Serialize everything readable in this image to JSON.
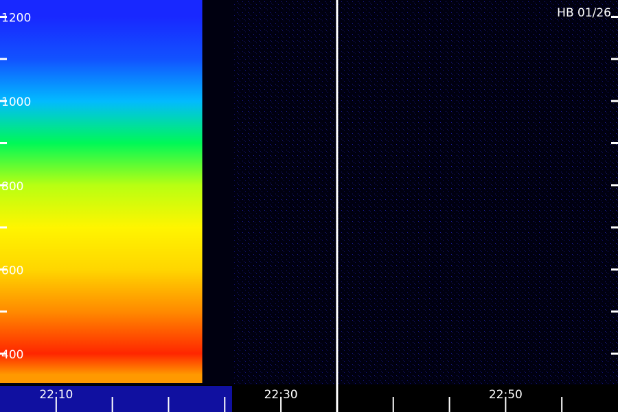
{
  "chart_data": {
    "type": "heatmap",
    "title": "",
    "station_label": "HB 01/26",
    "xlabel": "",
    "ylabel": "",
    "x_tick_labels": [
      "22:10",
      "22:30",
      "22:50"
    ],
    "x_major_ticks": [
      "22:10",
      "22:30",
      "22:50"
    ],
    "x_range": [
      "22:05",
      "23:00"
    ],
    "x_tick_interval_minutes": 5,
    "y_tick_labels": [
      "400",
      "600",
      "800",
      "1000",
      "1200"
    ],
    "y_tick_values": [
      400,
      600,
      800,
      1000,
      1200
    ],
    "y_minor_tick_interval": 100,
    "ylim": [
      330,
      1240
    ],
    "grid": false,
    "color_scale": [
      "#000033",
      "#1a1aff",
      "#00c8ff",
      "#00ff40",
      "#ffff00",
      "#ff8000",
      "#ff0000"
    ],
    "active_period": {
      "start": "22:05",
      "end": "22:23"
    },
    "separator_time": "22:35",
    "intensity_profile": [
      {
        "y": 1200,
        "level": 0.18
      },
      {
        "y": 1100,
        "level": 0.22
      },
      {
        "y": 1000,
        "level": 0.32
      },
      {
        "y": 900,
        "level": 0.48
      },
      {
        "y": 800,
        "level": 0.62
      },
      {
        "y": 700,
        "level": 0.68
      },
      {
        "y": 600,
        "level": 0.72
      },
      {
        "y": 500,
        "level": 0.82
      },
      {
        "y": 400,
        "level": 0.95
      },
      {
        "y": 350,
        "level": 0.8
      }
    ]
  }
}
